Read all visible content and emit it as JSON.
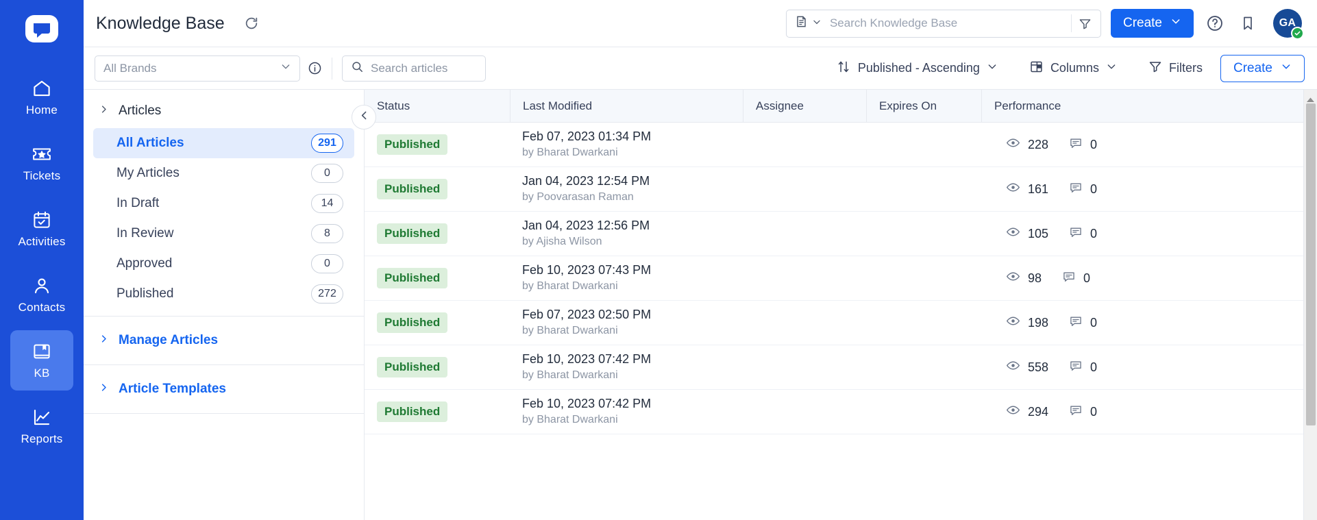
{
  "rail": {
    "logo_icon": "app-logo-icon",
    "items": [
      {
        "label": "Home",
        "icon": "home-icon",
        "active": false
      },
      {
        "label": "Tickets",
        "icon": "ticket-icon",
        "active": false
      },
      {
        "label": "Activities",
        "icon": "calendar-check-icon",
        "active": false
      },
      {
        "label": "Contacts",
        "icon": "person-icon",
        "active": false
      },
      {
        "label": "KB",
        "icon": "book-icon",
        "active": true
      },
      {
        "label": "Reports",
        "icon": "chart-line-icon",
        "active": false
      }
    ]
  },
  "header": {
    "title": "Knowledge Base",
    "refresh_icon": "refresh-icon",
    "search": {
      "type_icon": "article-type-icon",
      "chevron_icon": "chevron-down-icon",
      "placeholder": "Search Knowledge Base",
      "value": "",
      "filter_icon": "filter-funnel-icon"
    },
    "create_label": "Create",
    "create_chevron_icon": "chevron-down-icon",
    "help_icon": "help-circle-icon",
    "bookmark_icon": "bookmark-icon",
    "avatar_initials": "GA",
    "avatar_badge_icon": "check-badge-icon",
    "accent_color": "#1565f0"
  },
  "toolbar": {
    "brand_select_value": "All Brands",
    "brand_chevron_icon": "chevron-down-icon",
    "info_icon": "info-circle-icon",
    "article_search_icon": "search-icon",
    "article_search_placeholder": "Search articles",
    "article_search_value": "",
    "sort_icon": "sort-arrows-icon",
    "sort_label": "Published - Ascending",
    "sort_chevron_icon": "chevron-down-icon",
    "columns_icon": "columns-icon",
    "columns_label": "Columns",
    "columns_chevron_icon": "chevron-down-icon",
    "filters_icon": "filter-funnel-icon",
    "filters_label": "Filters",
    "create_label": "Create",
    "create_chevron_icon": "chevron-down-icon"
  },
  "tree": {
    "collapse_icon": "chevron-left-icon",
    "articles_group": {
      "label": "Articles",
      "chevron_icon": "chevron-right-icon"
    },
    "items": [
      {
        "label": "All Articles",
        "count": "291",
        "active": true
      },
      {
        "label": "My Articles",
        "count": "0",
        "active": false
      },
      {
        "label": "In Draft",
        "count": "14",
        "active": false
      },
      {
        "label": "In Review",
        "count": "8",
        "active": false
      },
      {
        "label": "Approved",
        "count": "0",
        "active": false
      },
      {
        "label": "Published",
        "count": "272",
        "active": false
      }
    ],
    "manage_articles": {
      "label": "Manage Articles",
      "chevron_icon": "chevron-right-icon"
    },
    "article_templates": {
      "label": "Article Templates",
      "chevron_icon": "chevron-right-icon"
    }
  },
  "table": {
    "columns": [
      "Status",
      "Last Modified",
      "Assignee",
      "Expires On",
      "Performance"
    ],
    "views_icon": "eye-icon",
    "comments_icon": "comment-icon",
    "rows": [
      {
        "status": "Published",
        "modified": "Feb 07, 2023 01:34 PM",
        "by": "by Bharat Dwarkani",
        "assignee": "",
        "expires": "",
        "views": "228",
        "comments": "0"
      },
      {
        "status": "Published",
        "modified": "Jan 04, 2023 12:54 PM",
        "by": "by Poovarasan Raman",
        "assignee": "",
        "expires": "",
        "views": "161",
        "comments": "0"
      },
      {
        "status": "Published",
        "modified": "Jan 04, 2023 12:56 PM",
        "by": "by Ajisha Wilson",
        "assignee": "",
        "expires": "",
        "views": "105",
        "comments": "0"
      },
      {
        "status": "Published",
        "modified": "Feb 10, 2023 07:43 PM",
        "by": "by Bharat Dwarkani",
        "assignee": "",
        "expires": "",
        "views": "98",
        "comments": "0"
      },
      {
        "status": "Published",
        "modified": "Feb 07, 2023 02:50 PM",
        "by": "by Bharat Dwarkani",
        "assignee": "",
        "expires": "",
        "views": "198",
        "comments": "0"
      },
      {
        "status": "Published",
        "modified": "Feb 10, 2023 07:42 PM",
        "by": "by Bharat Dwarkani",
        "assignee": "",
        "expires": "",
        "views": "558",
        "comments": "0"
      },
      {
        "status": "Published",
        "modified": "Feb 10, 2023 07:42 PM",
        "by": "by Bharat Dwarkani",
        "assignee": "",
        "expires": "",
        "views": "294",
        "comments": "0"
      }
    ]
  },
  "annotation": {
    "color": "#f00c0c",
    "target_column": "Performance"
  },
  "scrollbar": {
    "up_arrow_icon": "scroll-up-arrow-icon"
  }
}
